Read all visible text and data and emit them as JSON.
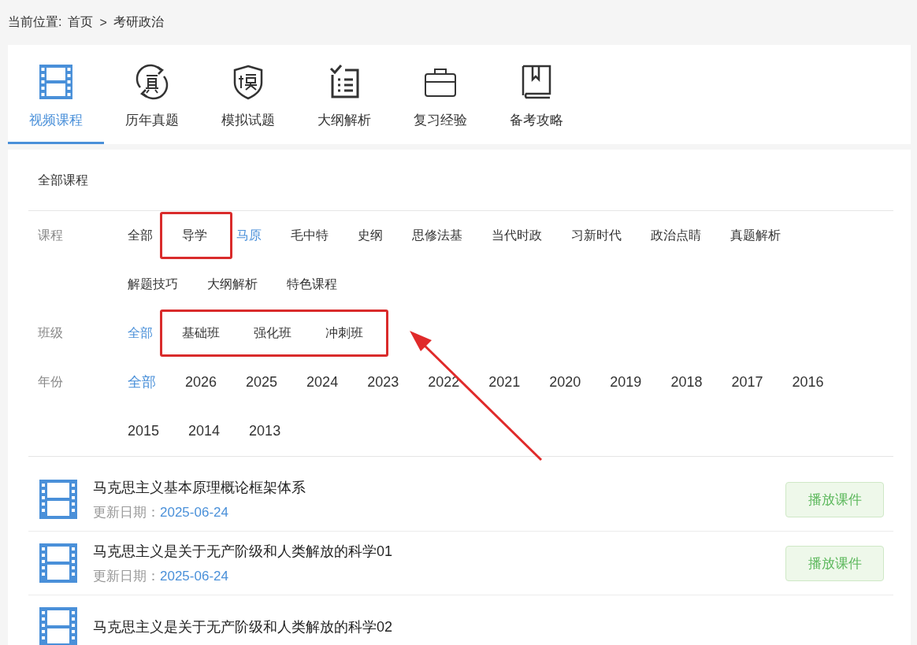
{
  "breadcrumb": {
    "label": "当前位置:",
    "items": [
      "首页",
      "考研政治"
    ],
    "separator": ">"
  },
  "tabs": [
    {
      "label": "视频课程",
      "kind": "film",
      "selected": true
    },
    {
      "label": "历年真题",
      "kind": "zhen",
      "selected": false
    },
    {
      "label": "模拟试题",
      "kind": "shield",
      "selected": false
    },
    {
      "label": "大纲解析",
      "kind": "checklist",
      "selected": false
    },
    {
      "label": "复习经验",
      "kind": "briefcase",
      "selected": false
    },
    {
      "label": "备考攻略",
      "kind": "book",
      "selected": false
    }
  ],
  "filter_title": "全部课程",
  "filters": [
    {
      "label": "课程",
      "options": [
        {
          "label": "全部",
          "selected": false,
          "highlighted": false
        },
        {
          "label": "导学",
          "selected": false,
          "highlighted": true
        },
        {
          "label": "马原",
          "selected": true,
          "highlighted": false
        },
        {
          "label": "毛中特",
          "selected": false,
          "highlighted": false
        },
        {
          "label": "史纲",
          "selected": false,
          "highlighted": false
        },
        {
          "label": "思修法基",
          "selected": false,
          "highlighted": false
        },
        {
          "label": "当代时政",
          "selected": false,
          "highlighted": false
        },
        {
          "label": "习新时代",
          "selected": false,
          "highlighted": false
        },
        {
          "label": "政治点睛",
          "selected": false,
          "highlighted": false
        },
        {
          "label": "真题解析",
          "selected": false,
          "highlighted": false
        },
        {
          "label": "解题技巧",
          "selected": false,
          "highlighted": false
        },
        {
          "label": "大纲解析",
          "selected": false,
          "highlighted": false
        },
        {
          "label": "特色课程",
          "selected": false,
          "highlighted": false
        }
      ]
    },
    {
      "label": "班级",
      "options": [
        {
          "label": "全部",
          "selected": true,
          "highlighted": false
        },
        {
          "label": "基础班",
          "selected": false,
          "highlighted": true
        },
        {
          "label": "强化班",
          "selected": false,
          "highlighted": true
        },
        {
          "label": "冲刺班",
          "selected": false,
          "highlighted": true
        }
      ]
    },
    {
      "label": "年份",
      "options": [
        {
          "label": "全部",
          "selected": true,
          "highlighted": false
        },
        {
          "label": "2026",
          "selected": false,
          "highlighted": false
        },
        {
          "label": "2025",
          "selected": false,
          "highlighted": false
        },
        {
          "label": "2024",
          "selected": false,
          "highlighted": false
        },
        {
          "label": "2023",
          "selected": false,
          "highlighted": false
        },
        {
          "label": "2022",
          "selected": false,
          "highlighted": false
        },
        {
          "label": "2021",
          "selected": false,
          "highlighted": false
        },
        {
          "label": "2020",
          "selected": false,
          "highlighted": false
        },
        {
          "label": "2019",
          "selected": false,
          "highlighted": false
        },
        {
          "label": "2018",
          "selected": false,
          "highlighted": false
        },
        {
          "label": "2017",
          "selected": false,
          "highlighted": false
        },
        {
          "label": "2016",
          "selected": false,
          "highlighted": false
        },
        {
          "label": "2015",
          "selected": false,
          "highlighted": false
        },
        {
          "label": "2014",
          "selected": false,
          "highlighted": false
        },
        {
          "label": "2013",
          "selected": false,
          "highlighted": false
        }
      ]
    }
  ],
  "courses": [
    {
      "title": "马克思主义基本原理概论框架体系",
      "date_label": "更新日期：",
      "date": "2025-06-24",
      "button": "播放课件"
    },
    {
      "title": "马克思主义是关于无产阶级和人类解放的科学01",
      "date_label": "更新日期：",
      "date": "2025-06-24",
      "button": "播放课件"
    },
    {
      "title": "马克思主义是关于无产阶级和人类解放的科学02"
    }
  ]
}
